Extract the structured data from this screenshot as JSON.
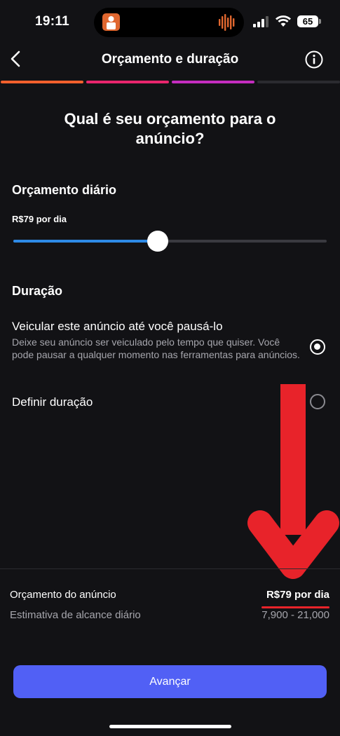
{
  "status_bar": {
    "time": "19:11",
    "battery": "65"
  },
  "header": {
    "title": "Orçamento e duração",
    "back_icon": "chevron-left",
    "info_icon": "info-circle"
  },
  "progress": {
    "total_steps": 4,
    "completed_steps": 3,
    "colors": [
      "#f2602d",
      "#e8256d",
      "#c42dbf",
      "#2b2b30"
    ]
  },
  "question": "Qual é seu orçamento para o anúncio?",
  "budget": {
    "heading": "Orçamento diário",
    "value_label": "R$79 por dia",
    "slider_fraction": 0.46
  },
  "duration": {
    "heading": "Duração",
    "options": [
      {
        "title": "Veicular este anúncio até você pausá-lo",
        "description": "Deixe seu anúncio ser veiculado pelo tempo que quiser. Você pode pausar a qualquer momento nas ferramentas para anúncios.",
        "selected": true
      },
      {
        "title": "Definir duração",
        "selected": false
      }
    ]
  },
  "summary": {
    "budget_label": "Orçamento do anúncio",
    "budget_value": "R$79 por dia",
    "reach_label": "Estimativa de alcance diário",
    "reach_value": "7,900 - 21,000"
  },
  "cta": {
    "label": "Avançar"
  },
  "colors": {
    "background": "#121215",
    "accent": "#5160f5",
    "slider": "#2e8ae6",
    "annotation": "#e8232a"
  }
}
